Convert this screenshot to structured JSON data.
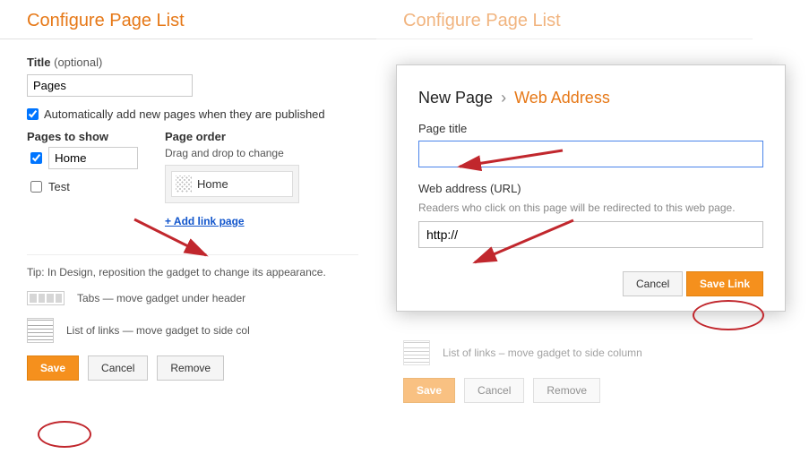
{
  "left": {
    "heading": "Configure Page List",
    "title_label_bold": "Title",
    "title_label_muted": " (optional)",
    "title_value": "Pages",
    "auto_add_label": "Automatically add new pages when they are published",
    "auto_add_checked": true,
    "columns": {
      "show_label": "Pages to show",
      "order_label": "Page order",
      "order_hint": "Drag and drop to change"
    },
    "pages": [
      {
        "name": "Home",
        "checked": true,
        "in_order": true
      },
      {
        "name": "Test",
        "checked": false,
        "in_order": false
      }
    ],
    "add_link_label": "+ Add link page",
    "tip": "Tip: In Design, reposition the gadget to change its appearance.",
    "hint_tabs": "Tabs — move gadget under header",
    "hint_list": "List of links — move gadget to side col",
    "btn_save": "Save",
    "btn_cancel": "Cancel",
    "btn_remove": "Remove"
  },
  "right": {
    "heading": "Configure Page List",
    "hint_list": "List of links – move gadget to side column",
    "btn_save": "Save",
    "btn_cancel": "Cancel",
    "btn_remove": "Remove"
  },
  "modal": {
    "crumb1": "New Page",
    "crumb_sep": "›",
    "crumb2": "Web Address",
    "title_label": "Page title",
    "title_value": "",
    "url_label": "Web address (URL)",
    "url_help": "Readers who click on this page will be redirected to this web page.",
    "url_value": "http://",
    "btn_cancel": "Cancel",
    "btn_save": "Save Link"
  }
}
